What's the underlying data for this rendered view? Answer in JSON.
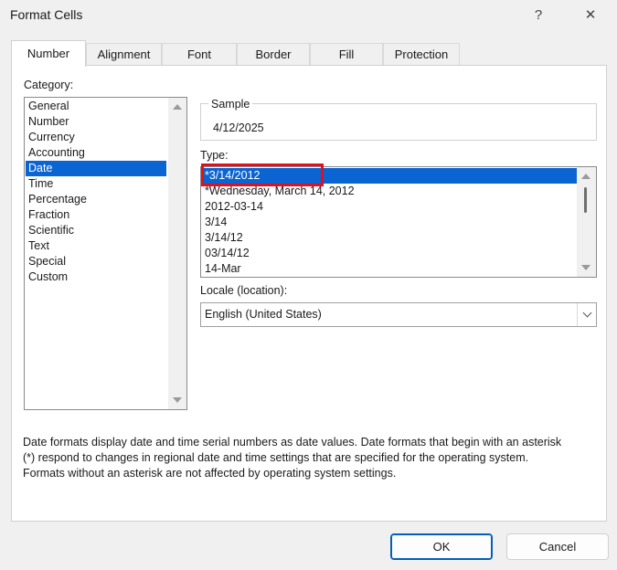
{
  "window": {
    "title": "Format Cells",
    "help_glyph": "?",
    "close_glyph": "✕"
  },
  "tabs": [
    {
      "label": "Number",
      "active": true
    },
    {
      "label": "Alignment",
      "active": false
    },
    {
      "label": "Font",
      "active": false
    },
    {
      "label": "Border",
      "active": false
    },
    {
      "label": "Fill",
      "active": false
    },
    {
      "label": "Protection",
      "active": false
    }
  ],
  "category": {
    "label": "Category:",
    "items": [
      "General",
      "Number",
      "Currency",
      "Accounting",
      "Date",
      "Time",
      "Percentage",
      "Fraction",
      "Scientific",
      "Text",
      "Special",
      "Custom"
    ],
    "selected": "Date"
  },
  "sample": {
    "label": "Sample",
    "value": "4/12/2025"
  },
  "type": {
    "label": "Type:",
    "items": [
      "*3/14/2012",
      "*Wednesday, March 14, 2012",
      "2012-03-14",
      "3/14",
      "3/14/12",
      "03/14/12",
      "14-Mar"
    ],
    "selected": "*3/14/2012"
  },
  "locale": {
    "label": "Locale (location):",
    "value": "English (United States)"
  },
  "description": {
    "lines": [
      "Date formats display date and time serial numbers as date values.  Date formats that begin with an asterisk",
      "(*) respond to changes in regional date and time settings that are specified for the operating system.",
      "Formats without an asterisk are not affected by operating system settings."
    ]
  },
  "buttons": {
    "ok": "OK",
    "cancel": "Cancel"
  },
  "colors": {
    "selection": "#0a64d2",
    "highlight_box": "#e0101e",
    "ok_border": "#005fb8"
  }
}
